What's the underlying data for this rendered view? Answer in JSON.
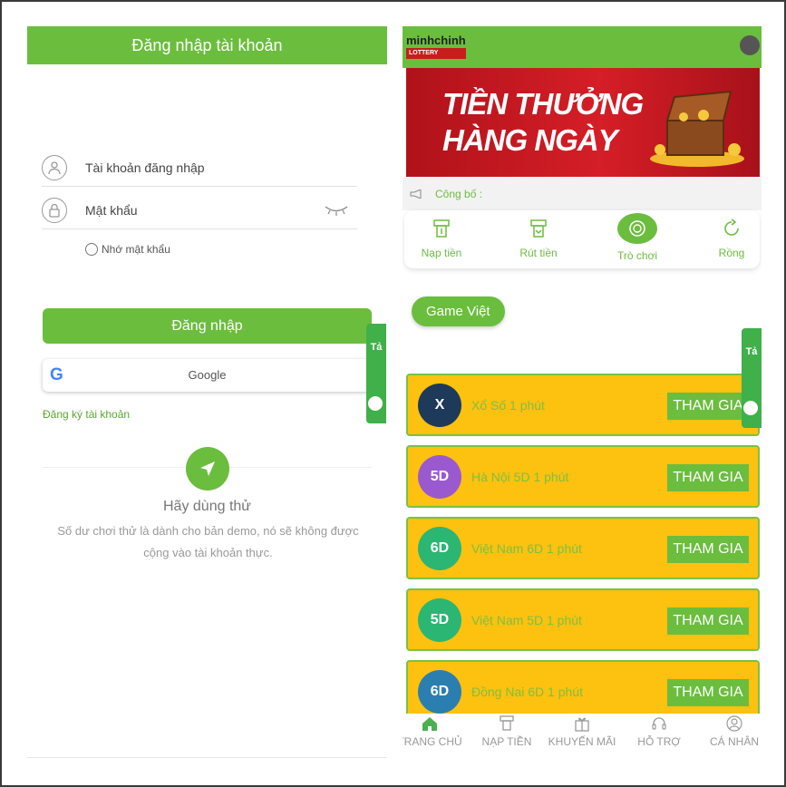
{
  "login": {
    "title": "Đăng nhập tài khoản",
    "username_label": "Tài khoản đăng nhập",
    "password_label": "Mật khẩu",
    "remember_label": "Nhớ mật khẩu",
    "login_button": "Đăng nhập",
    "google_button": "Google",
    "register_link": "Đăng ký tài khoản",
    "try_title": "Hãy dùng thử",
    "try_desc": "Số dư chơi thử là dành cho bản demo, nó sẽ không được cộng vào tài khoản thực.",
    "side_tab": "Tả"
  },
  "app": {
    "logo_main": "minhchinh",
    "logo_sub": "LOTTERY",
    "banner_line1": "TIỀN THƯỞNG",
    "banner_line2": "HÀNG NGÀY",
    "announce_label": "Công bố :",
    "quick_actions": [
      {
        "label": "Nạp tiền",
        "icon": "atm-deposit-icon"
      },
      {
        "label": "Rút tiền",
        "icon": "atm-withdraw-icon"
      },
      {
        "label": "Trò chơi",
        "icon": "coin-icon"
      },
      {
        "label": "Rồng",
        "icon": "refresh-icon"
      }
    ],
    "category_chip": "Game Việt",
    "side_tab": "Tả",
    "games": [
      {
        "name": "Xổ Số 1 phút",
        "button": "THAM GIA",
        "icon_text": "X",
        "icon_color": "#1d3a5a"
      },
      {
        "name": "Hà Nội 5D 1 phút",
        "button": "THAM GIA",
        "icon_text": "5D",
        "icon_color": "#9b59d0"
      },
      {
        "name": "Việt Nam 6D 1 phút",
        "button": "THAM GIA",
        "icon_text": "6D",
        "icon_color": "#2bb673"
      },
      {
        "name": "Việt Nam 5D 1 phút",
        "button": "THAM GIA",
        "icon_text": "5D",
        "icon_color": "#2bb673"
      },
      {
        "name": "Đồng Nai 6D 1 phút",
        "button": "THAM GIA",
        "icon_text": "6D",
        "icon_color": "#2a7fb0"
      }
    ],
    "bottom_nav": [
      {
        "label": "TRANG CHỦ",
        "icon": "home-icon"
      },
      {
        "label": "NẠP TIỀN",
        "icon": "atm-icon"
      },
      {
        "label": "KHUYẾN MÃI",
        "icon": "gift-icon"
      },
      {
        "label": "HỖ TRỢ",
        "icon": "headset-icon"
      },
      {
        "label": "CÁ NHÂN",
        "icon": "user-icon"
      }
    ]
  },
  "colors": {
    "primary": "#6bbd3e",
    "card": "#fdc10f",
    "banner": "#d51e27"
  }
}
